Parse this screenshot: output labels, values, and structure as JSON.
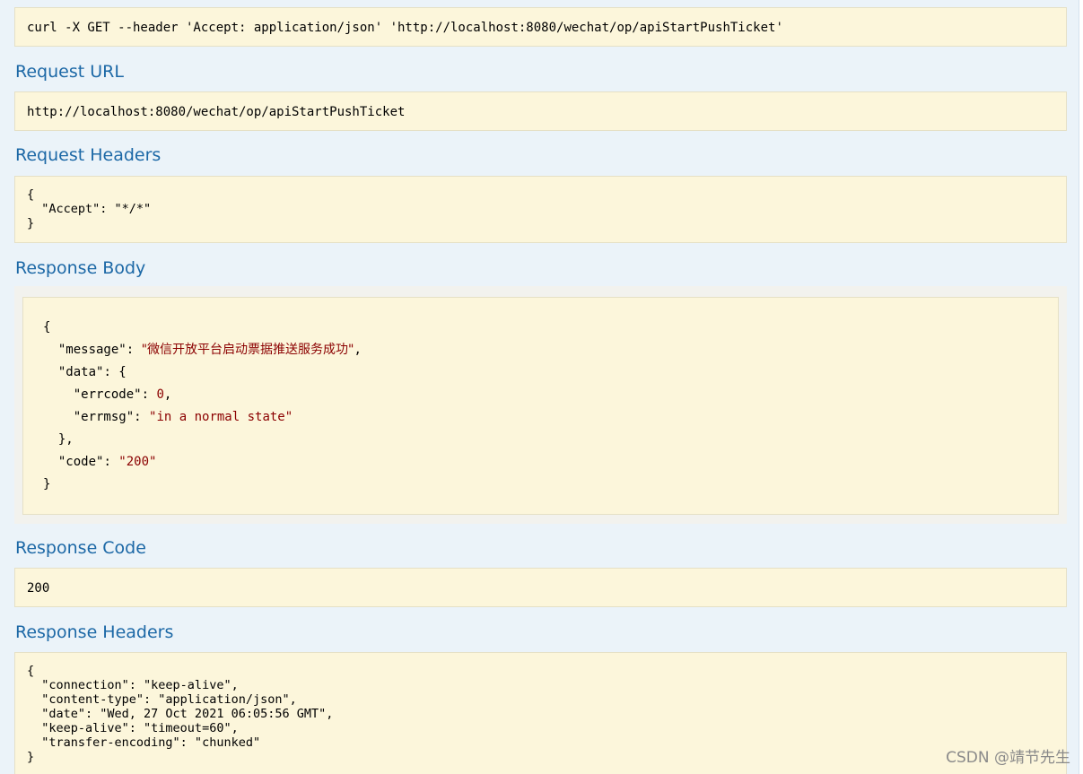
{
  "curl": {
    "command": "curl -X GET --header 'Accept: application/json' 'http://localhost:8080/wechat/op/apiStartPushTicket'"
  },
  "request_url": {
    "title": "Request URL",
    "value": "http://localhost:8080/wechat/op/apiStartPushTicket"
  },
  "request_headers": {
    "title": "Request Headers",
    "value": "{\n  \"Accept\": \"*/*\"\n}"
  },
  "response_body": {
    "title": "Response Body",
    "open_brace": "{",
    "close_brace": "}",
    "message_key": "\"message\"",
    "message_value": "\"微信开放平台启动票据推送服务成功\"",
    "data_key": "\"data\"",
    "errcode_key": "\"errcode\"",
    "errcode_value": "0",
    "errmsg_key": "\"errmsg\"",
    "errmsg_value": "\"in a normal state\"",
    "code_key": "\"code\"",
    "code_value": "\"200\""
  },
  "response_code": {
    "title": "Response Code",
    "value": "200"
  },
  "response_headers": {
    "title": "Response Headers",
    "value": "{\n  \"connection\": \"keep-alive\",\n  \"content-type\": \"application/json\",\n  \"date\": \"Wed, 27 Oct 2021 06:05:56 GMT\",\n  \"keep-alive\": \"timeout=60\",\n  \"transfer-encoding\": \"chunked\"\n}"
  },
  "watermark": {
    "text": "CSDN @靖节先生"
  }
}
